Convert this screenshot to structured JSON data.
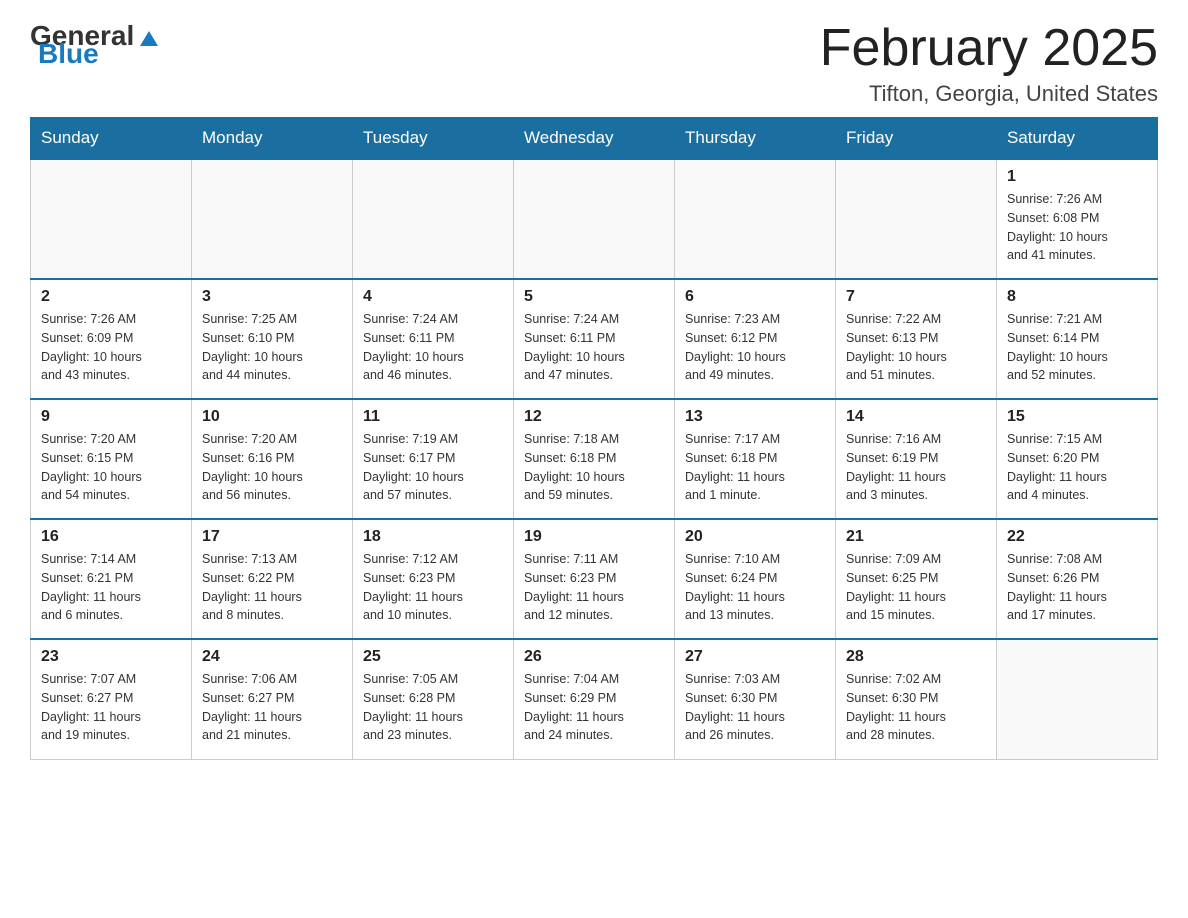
{
  "logo": {
    "general": "General",
    "blue": "Blue",
    "alt": "GeneralBlue logo"
  },
  "header": {
    "title": "February 2025",
    "subtitle": "Tifton, Georgia, United States"
  },
  "weekdays": [
    "Sunday",
    "Monday",
    "Tuesday",
    "Wednesday",
    "Thursday",
    "Friday",
    "Saturday"
  ],
  "weeks": [
    [
      {
        "day": "",
        "info": ""
      },
      {
        "day": "",
        "info": ""
      },
      {
        "day": "",
        "info": ""
      },
      {
        "day": "",
        "info": ""
      },
      {
        "day": "",
        "info": ""
      },
      {
        "day": "",
        "info": ""
      },
      {
        "day": "1",
        "info": "Sunrise: 7:26 AM\nSunset: 6:08 PM\nDaylight: 10 hours\nand 41 minutes."
      }
    ],
    [
      {
        "day": "2",
        "info": "Sunrise: 7:26 AM\nSunset: 6:09 PM\nDaylight: 10 hours\nand 43 minutes."
      },
      {
        "day": "3",
        "info": "Sunrise: 7:25 AM\nSunset: 6:10 PM\nDaylight: 10 hours\nand 44 minutes."
      },
      {
        "day": "4",
        "info": "Sunrise: 7:24 AM\nSunset: 6:11 PM\nDaylight: 10 hours\nand 46 minutes."
      },
      {
        "day": "5",
        "info": "Sunrise: 7:24 AM\nSunset: 6:11 PM\nDaylight: 10 hours\nand 47 minutes."
      },
      {
        "day": "6",
        "info": "Sunrise: 7:23 AM\nSunset: 6:12 PM\nDaylight: 10 hours\nand 49 minutes."
      },
      {
        "day": "7",
        "info": "Sunrise: 7:22 AM\nSunset: 6:13 PM\nDaylight: 10 hours\nand 51 minutes."
      },
      {
        "day": "8",
        "info": "Sunrise: 7:21 AM\nSunset: 6:14 PM\nDaylight: 10 hours\nand 52 minutes."
      }
    ],
    [
      {
        "day": "9",
        "info": "Sunrise: 7:20 AM\nSunset: 6:15 PM\nDaylight: 10 hours\nand 54 minutes."
      },
      {
        "day": "10",
        "info": "Sunrise: 7:20 AM\nSunset: 6:16 PM\nDaylight: 10 hours\nand 56 minutes."
      },
      {
        "day": "11",
        "info": "Sunrise: 7:19 AM\nSunset: 6:17 PM\nDaylight: 10 hours\nand 57 minutes."
      },
      {
        "day": "12",
        "info": "Sunrise: 7:18 AM\nSunset: 6:18 PM\nDaylight: 10 hours\nand 59 minutes."
      },
      {
        "day": "13",
        "info": "Sunrise: 7:17 AM\nSunset: 6:18 PM\nDaylight: 11 hours\nand 1 minute."
      },
      {
        "day": "14",
        "info": "Sunrise: 7:16 AM\nSunset: 6:19 PM\nDaylight: 11 hours\nand 3 minutes."
      },
      {
        "day": "15",
        "info": "Sunrise: 7:15 AM\nSunset: 6:20 PM\nDaylight: 11 hours\nand 4 minutes."
      }
    ],
    [
      {
        "day": "16",
        "info": "Sunrise: 7:14 AM\nSunset: 6:21 PM\nDaylight: 11 hours\nand 6 minutes."
      },
      {
        "day": "17",
        "info": "Sunrise: 7:13 AM\nSunset: 6:22 PM\nDaylight: 11 hours\nand 8 minutes."
      },
      {
        "day": "18",
        "info": "Sunrise: 7:12 AM\nSunset: 6:23 PM\nDaylight: 11 hours\nand 10 minutes."
      },
      {
        "day": "19",
        "info": "Sunrise: 7:11 AM\nSunset: 6:23 PM\nDaylight: 11 hours\nand 12 minutes."
      },
      {
        "day": "20",
        "info": "Sunrise: 7:10 AM\nSunset: 6:24 PM\nDaylight: 11 hours\nand 13 minutes."
      },
      {
        "day": "21",
        "info": "Sunrise: 7:09 AM\nSunset: 6:25 PM\nDaylight: 11 hours\nand 15 minutes."
      },
      {
        "day": "22",
        "info": "Sunrise: 7:08 AM\nSunset: 6:26 PM\nDaylight: 11 hours\nand 17 minutes."
      }
    ],
    [
      {
        "day": "23",
        "info": "Sunrise: 7:07 AM\nSunset: 6:27 PM\nDaylight: 11 hours\nand 19 minutes."
      },
      {
        "day": "24",
        "info": "Sunrise: 7:06 AM\nSunset: 6:27 PM\nDaylight: 11 hours\nand 21 minutes."
      },
      {
        "day": "25",
        "info": "Sunrise: 7:05 AM\nSunset: 6:28 PM\nDaylight: 11 hours\nand 23 minutes."
      },
      {
        "day": "26",
        "info": "Sunrise: 7:04 AM\nSunset: 6:29 PM\nDaylight: 11 hours\nand 24 minutes."
      },
      {
        "day": "27",
        "info": "Sunrise: 7:03 AM\nSunset: 6:30 PM\nDaylight: 11 hours\nand 26 minutes."
      },
      {
        "day": "28",
        "info": "Sunrise: 7:02 AM\nSunset: 6:30 PM\nDaylight: 11 hours\nand 28 minutes."
      },
      {
        "day": "",
        "info": ""
      }
    ]
  ]
}
